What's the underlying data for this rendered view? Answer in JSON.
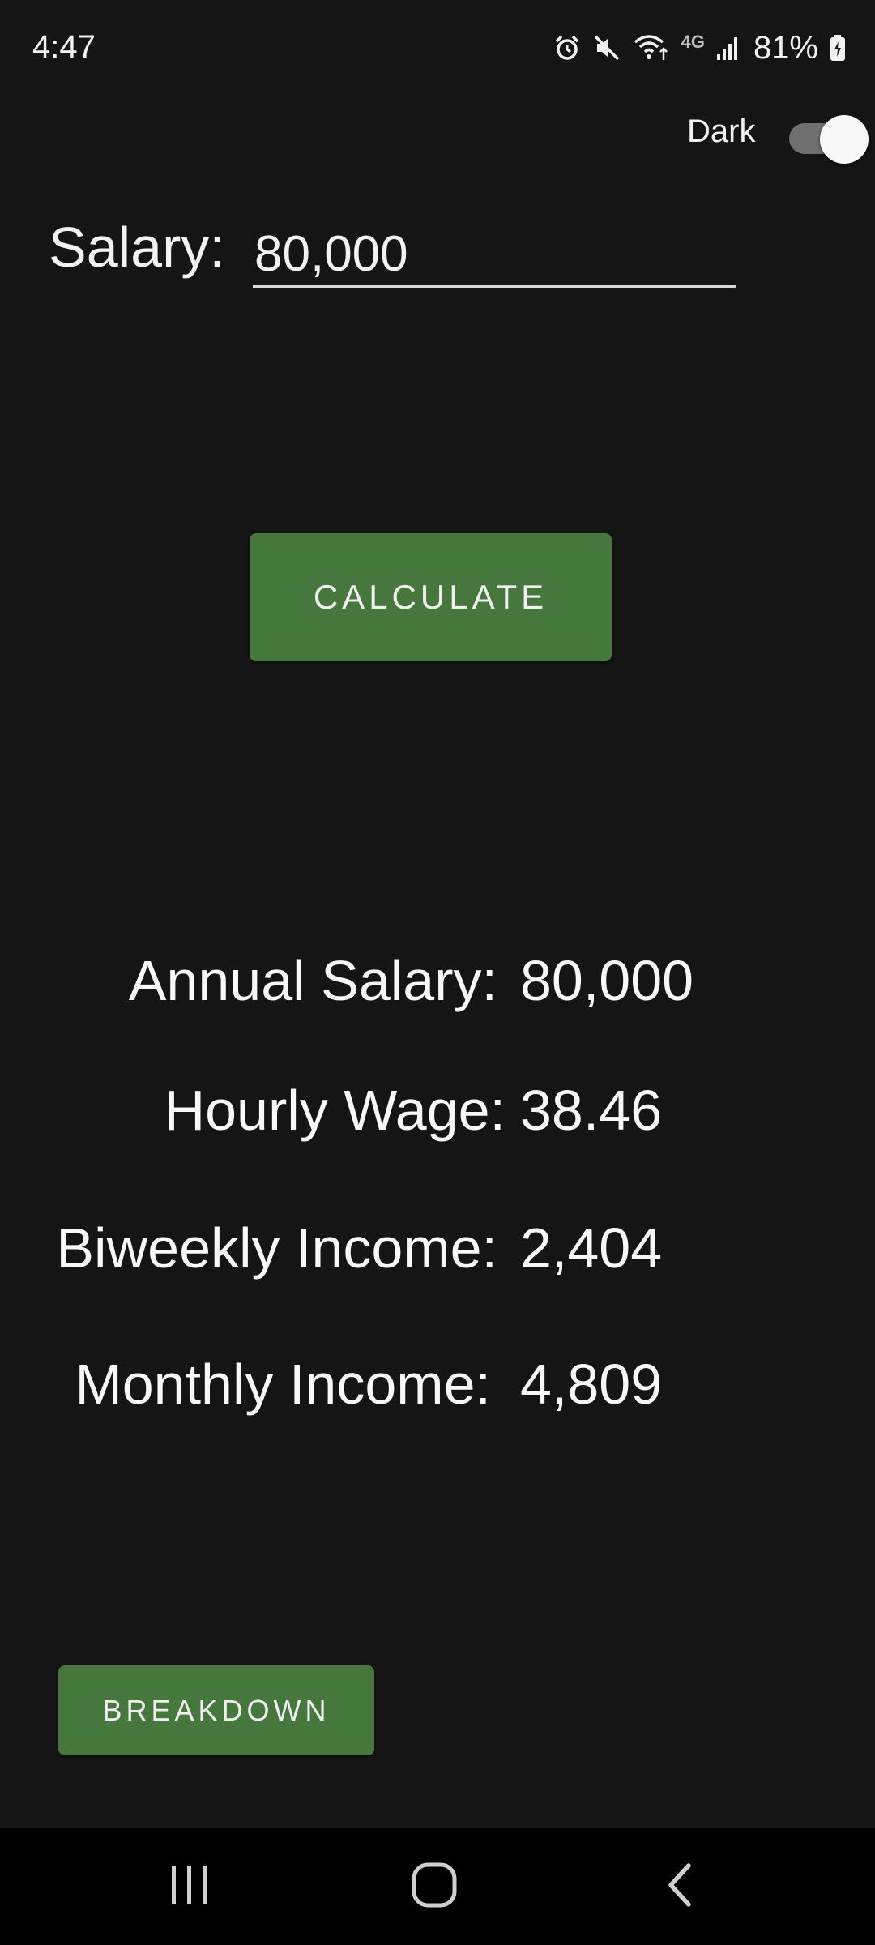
{
  "status_bar": {
    "time": "4:47",
    "network": "4G",
    "battery": "81%",
    "icons": [
      "alarm-icon",
      "mute-icon",
      "wifi-icon",
      "signal-icon",
      "battery-icon"
    ]
  },
  "theme": {
    "label": "Dark",
    "enabled": true
  },
  "salary": {
    "label": "Salary:",
    "value": "80,000"
  },
  "calculate_button": {
    "label": "CALCULATE"
  },
  "results": [
    {
      "label": "Annual Salary:",
      "value": "80,000"
    },
    {
      "label": "Hourly Wage:",
      "value": "38.46"
    },
    {
      "label": "Biweekly Income:",
      "value": "2,404"
    },
    {
      "label": "Monthly Income:",
      "value": "4,809"
    }
  ],
  "breakdown_button": {
    "label": "BREAKDOWN"
  },
  "nav_bar": {
    "icons": [
      "recents-icon",
      "home-icon",
      "back-icon"
    ]
  },
  "colors": {
    "background": "#151515",
    "button": "#46773d",
    "text": "#ffffff",
    "nav_background": "#000000"
  }
}
